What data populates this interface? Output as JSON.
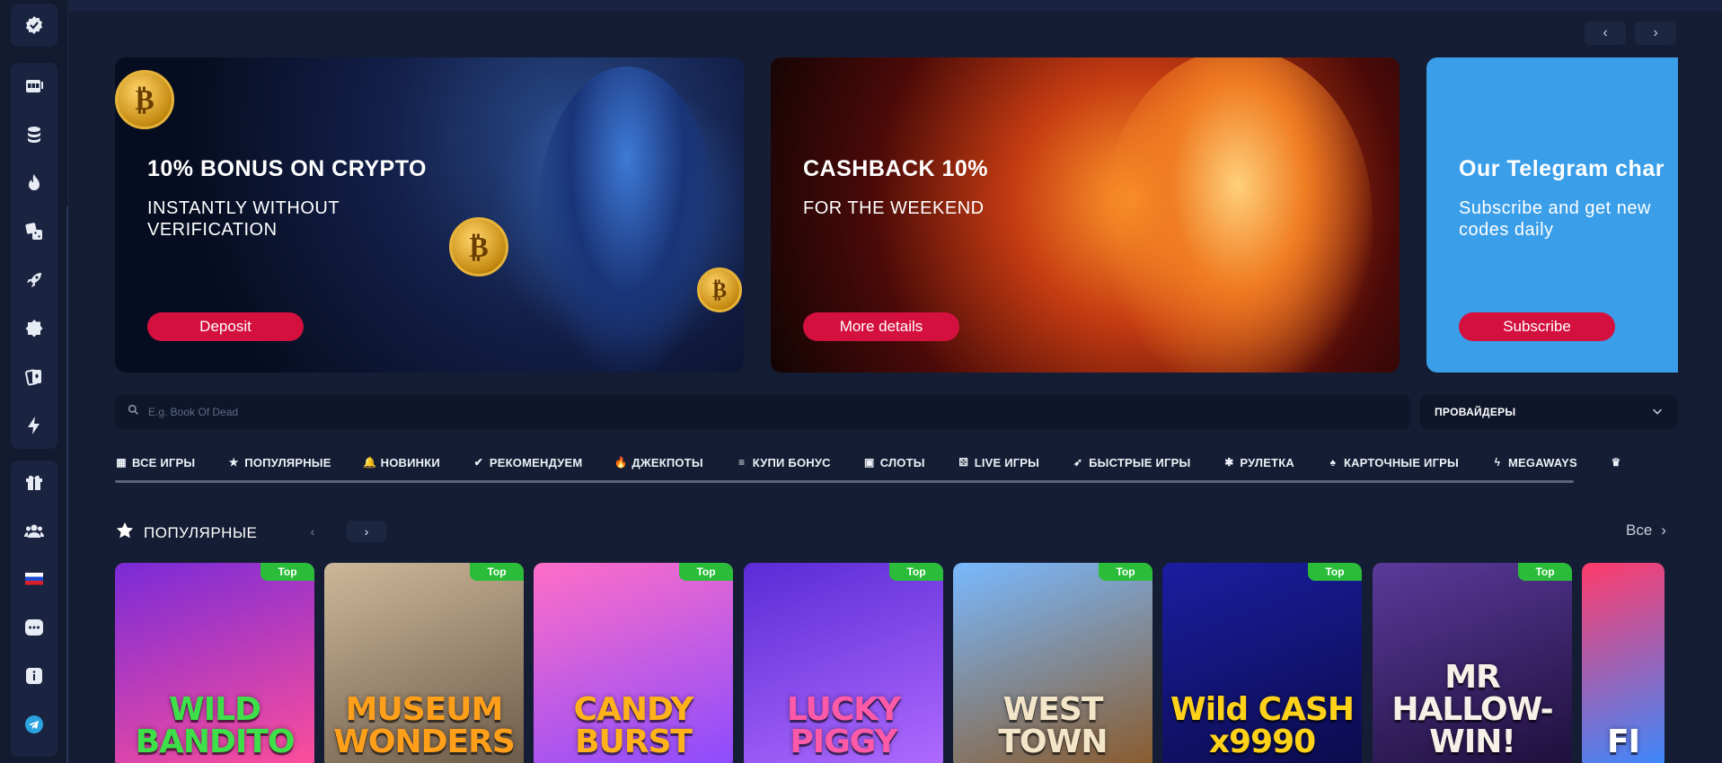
{
  "sidebar": {
    "top_icon": "badge-check-icon",
    "main_items": [
      {
        "icon": "slot-machine-icon"
      },
      {
        "icon": "coin-stack-icon"
      },
      {
        "icon": "flame-icon"
      },
      {
        "icon": "dice-icon"
      },
      {
        "icon": "rocket-icon"
      },
      {
        "icon": "roulette-icon"
      },
      {
        "icon": "cards-icon"
      },
      {
        "icon": "lightning-icon"
      }
    ],
    "bottom_items": [
      {
        "icon": "gift-icon"
      },
      {
        "icon": "users-icon"
      },
      {
        "icon": "russia-flag-icon"
      },
      {
        "icon": "chat-icon"
      },
      {
        "icon": "info-icon"
      },
      {
        "icon": "telegram-icon"
      }
    ]
  },
  "carousel": {
    "prev": "‹",
    "next": "›"
  },
  "banners": [
    {
      "title": "10% BONUS ON CRYPTO",
      "subtitle": "INSTANTLY WITHOUT VERIFICATION",
      "button": "Deposit"
    },
    {
      "title": "CASHBACK 10%",
      "subtitle": "FOR THE WEEKEND",
      "button": "More details"
    },
    {
      "title": "Our Telegram char",
      "subtitle": "Subscribe and get new codes daily",
      "button": "Subscribe"
    }
  ],
  "search": {
    "placeholder": "E.g. Book Of Dead"
  },
  "providers": {
    "label": "ПРОВАЙДЕРЫ"
  },
  "tabs": [
    {
      "label": "ВСЕ ИГРЫ",
      "icon": "▦"
    },
    {
      "label": "ПОПУЛЯРНЫЕ",
      "icon": "★"
    },
    {
      "label": "НОВИНКИ",
      "icon": "🔔"
    },
    {
      "label": "РЕКОМЕНДУЕМ",
      "icon": "✔"
    },
    {
      "label": "ДЖЕКПОТЫ",
      "icon": "🔥"
    },
    {
      "label": "КУПИ БОНУС",
      "icon": "≡"
    },
    {
      "label": "СЛОТЫ",
      "icon": "▣"
    },
    {
      "label": "LIVE ИГРЫ",
      "icon": "⚄"
    },
    {
      "label": "БЫСТРЫЕ ИГРЫ",
      "icon": "➶"
    },
    {
      "label": "РУЛЕТКА",
      "icon": "✱"
    },
    {
      "label": "КАРТОЧНЫЕ ИГРЫ",
      "icon": "♠"
    },
    {
      "label": "MEGAWAYS",
      "icon": "ϟ"
    },
    {
      "label": "",
      "icon": "♛"
    }
  ],
  "section": {
    "title": "ПОПУЛЯРНЫЕ",
    "all_label": "Все"
  },
  "games": [
    {
      "name": "WILD BANDITO",
      "badge": "Top",
      "bg1": "#7a2bd8",
      "bg2": "#ff4f9a",
      "fg": "#3ee04a"
    },
    {
      "name": "MUSEUM WONDERS",
      "badge": "Top",
      "bg1": "#cdb79a",
      "bg2": "#6b5a48",
      "fg": "#ff9f1a"
    },
    {
      "name": "CANDY BURST",
      "badge": "Top",
      "bg1": "#ff6ec7",
      "bg2": "#8a4bff",
      "fg": "#ffb21a"
    },
    {
      "name": "LUCKY PIGGY",
      "badge": "Top",
      "bg1": "#5b2bd6",
      "bg2": "#b06bff",
      "fg": "#ff5aa8"
    },
    {
      "name": "WEST TOWN",
      "badge": "Top",
      "bg1": "#79b9ff",
      "bg2": "#8a5a2a",
      "fg": "#f3e5c8"
    },
    {
      "name": "Wild CASH x9990",
      "badge": "Top",
      "bg1": "#1a1ea0",
      "bg2": "#0b0b4a",
      "fg": "#ffd21a"
    },
    {
      "name": "MR HALLOW-WIN!",
      "badge": "Top",
      "bg1": "#5a3a9a",
      "bg2": "#1d0f3a",
      "fg": "#f5f1e8"
    },
    {
      "name": "FI",
      "badge": "",
      "bg1": "#ff3b6b",
      "bg2": "#3a8aff",
      "fg": "#ffffff"
    }
  ]
}
